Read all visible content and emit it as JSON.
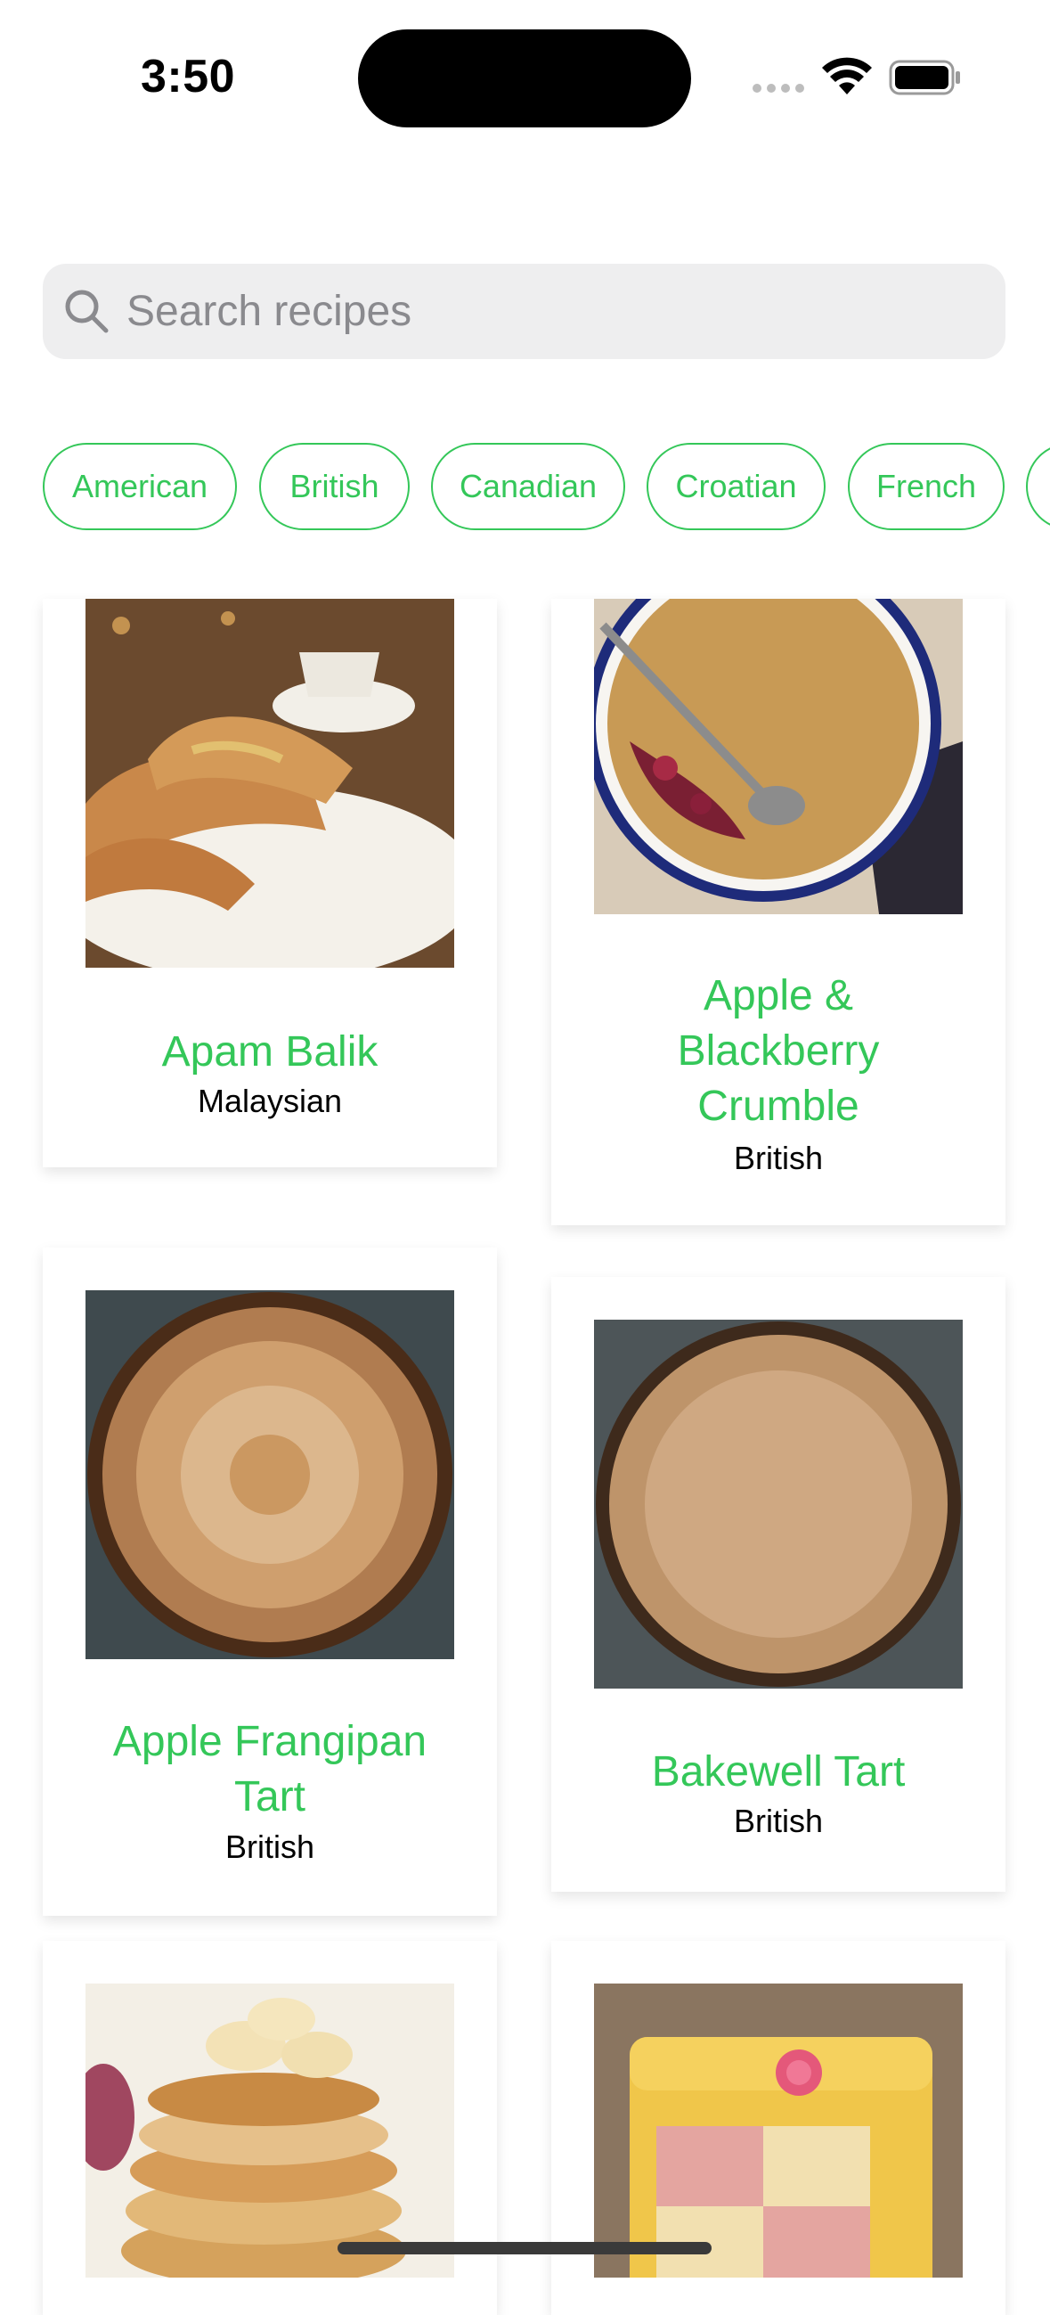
{
  "status_bar": {
    "time": "3:50"
  },
  "search": {
    "placeholder": "Search recipes",
    "value": ""
  },
  "cuisines": [
    "American",
    "British",
    "Canadian",
    "Croatian",
    "French",
    ""
  ],
  "recipes": [
    {
      "name": "Apam Balik",
      "cuisine": "Malaysian"
    },
    {
      "name": "Apple & Blackberry Crumble",
      "cuisine": "British"
    },
    {
      "name": "Apple Frangipan Tart",
      "cuisine": "British"
    },
    {
      "name": "Bakewell Tart",
      "cuisine": "British"
    },
    {
      "name": "",
      "cuisine": ""
    },
    {
      "name": "",
      "cuisine": ""
    }
  ],
  "colors": {
    "accent": "#34c759",
    "search_bg": "#eeeeef",
    "placeholder": "#8a8a8e"
  }
}
